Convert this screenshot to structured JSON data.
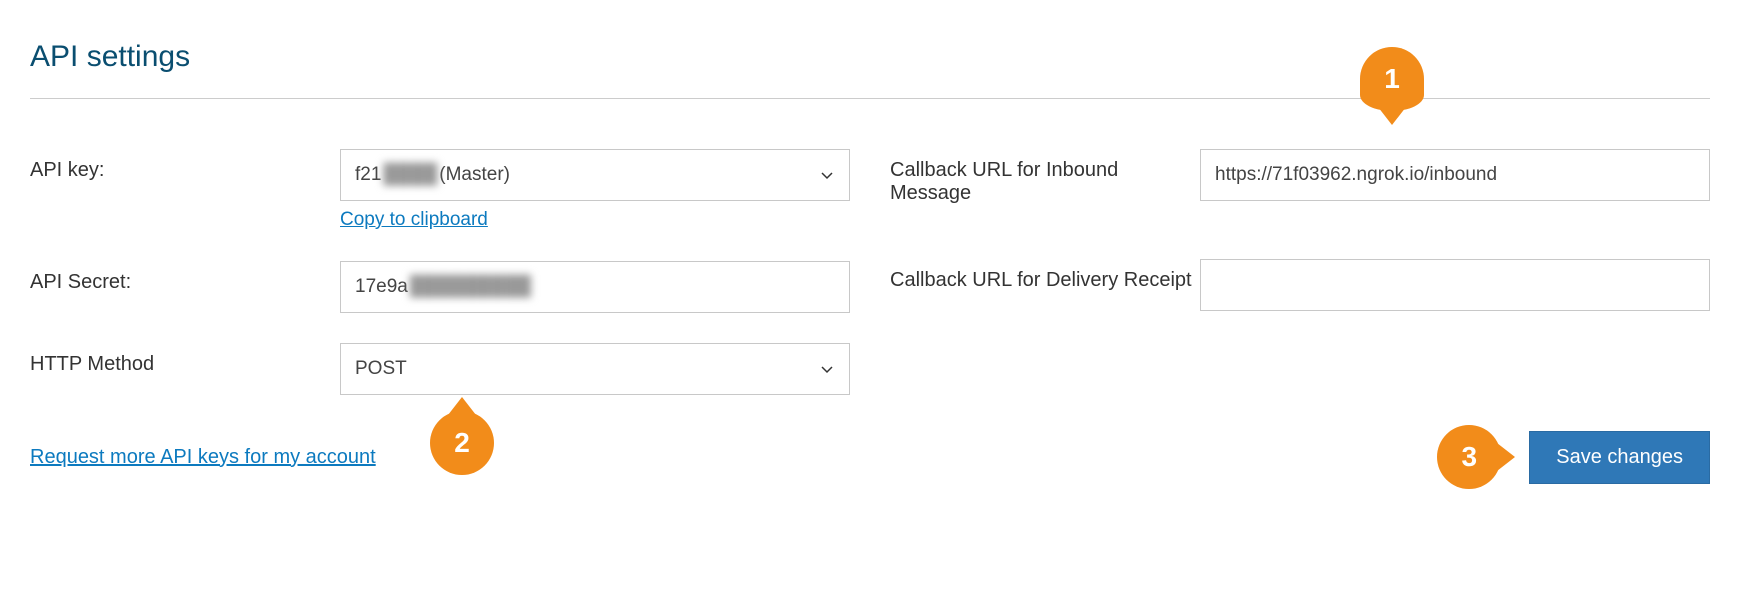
{
  "title": "API settings",
  "left": {
    "api_key": {
      "label": "API key:",
      "value_prefix": "f21",
      "value_blur": "████",
      "value_suffix": " (Master)",
      "copy_link": "Copy to clipboard"
    },
    "api_secret": {
      "label": "API Secret:",
      "value_prefix": "17e9a",
      "value_blur": "█████████"
    },
    "http_method": {
      "label": "HTTP Method",
      "value": "POST"
    }
  },
  "right": {
    "callback_inbound": {
      "label": "Callback URL for Inbound Message",
      "value": "https://71f03962.ngrok.io/inbound"
    },
    "callback_delivery": {
      "label": "Callback URL for Delivery Receipt",
      "value": ""
    }
  },
  "footer": {
    "request_link": "Request more API keys for my account",
    "save_button": "Save changes"
  },
  "annotations": {
    "one": "1",
    "two": "2",
    "three": "3"
  }
}
